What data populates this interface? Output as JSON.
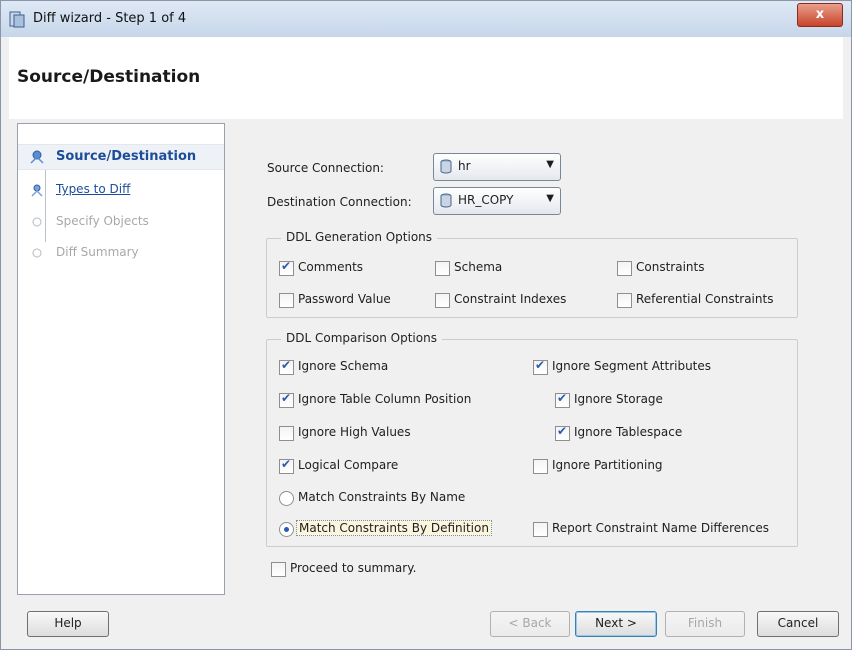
{
  "window": {
    "title": "Diff wizard - Step 1 of 4",
    "close_label": "x"
  },
  "banner": {
    "title": "Source/Destination"
  },
  "steps": [
    {
      "label": "Source/Destination",
      "state": "active"
    },
    {
      "label": "Types to Diff",
      "state": "link"
    },
    {
      "label": "Specify Objects",
      "state": "disabled"
    },
    {
      "label": "Diff Summary",
      "state": "disabled"
    }
  ],
  "connections": {
    "source_label": "Source Connection:",
    "source_value": "hr",
    "destination_label": "Destination Connection:",
    "destination_value": "HR_COPY"
  },
  "ddl_generation": {
    "title": "DDL Generation Options",
    "options": [
      {
        "label": "Comments",
        "checked": true
      },
      {
        "label": "Schema",
        "checked": false
      },
      {
        "label": "Constraints",
        "checked": false
      },
      {
        "label": "Password Value",
        "checked": false
      },
      {
        "label": "Constraint Indexes",
        "checked": false
      },
      {
        "label": "Referential Constraints",
        "checked": false
      }
    ]
  },
  "ddl_comparison": {
    "title": "DDL Comparison Options",
    "options": [
      {
        "label": "Ignore Schema",
        "checked": true
      },
      {
        "label": "Ignore Segment Attributes",
        "checked": true
      },
      {
        "label": "Ignore Table Column Position",
        "checked": true
      },
      {
        "label": "Ignore Storage",
        "checked": true
      },
      {
        "label": "Ignore High Values",
        "checked": false
      },
      {
        "label": "Ignore Tablespace",
        "checked": true
      },
      {
        "label": "Logical Compare",
        "checked": true
      },
      {
        "label": "Ignore Partitioning",
        "checked": false
      },
      {
        "label": "Match Constraints By Name",
        "checked": false
      },
      {
        "label": "Match Constraints By Definition",
        "checked": true
      },
      {
        "label": "Report Constraint Name Differences",
        "checked": false
      }
    ]
  },
  "proceed": {
    "label": "Proceed to summary.",
    "checked": false
  },
  "buttons": {
    "help": "Help",
    "back": "< Back",
    "next": "Next >",
    "finish": "Finish",
    "cancel": "Cancel"
  }
}
